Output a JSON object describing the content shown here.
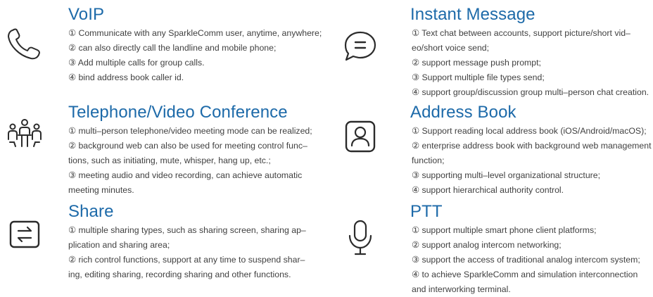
{
  "features": {
    "voip": {
      "icon": "phone-icon",
      "title": "VoIP",
      "lines": [
        "① Communicate with any SparkleComm user, anytime, anywhere;",
        "② can also directly call the landline and mobile phone;",
        "③ Add multiple calls for group calls.",
        "④ bind address book caller id."
      ]
    },
    "conference": {
      "icon": "meeting-people-icon",
      "title": "Telephone/Video Conference",
      "lines": [
        "① multi–person telephone/video meeting mode can be realized;",
        "② background web can also be used for meeting control func–",
        "tions, such as initiating, mute, whisper, hang up, etc.;",
        "③ meeting audio and video recording, can achieve automatic",
        "meeting minutes."
      ]
    },
    "share": {
      "icon": "share-arrows-icon",
      "title": "Share",
      "lines": [
        "① multiple sharing types, such as sharing screen, sharing ap–",
        "plication and sharing area;",
        "② rich control functions, support at any time to suspend shar–",
        "ing, editing sharing, recording sharing and other functions."
      ]
    },
    "im": {
      "icon": "chat-bubble-icon",
      "title": "Instant Message",
      "lines": [
        "① Text chat between accounts, support picture/short vid–",
        "eo/short voice send;",
        "② support message push prompt;",
        "③ Support multiple file types send;",
        "④ support group/discussion group multi–person chat creation."
      ]
    },
    "address": {
      "icon": "contact-person-icon",
      "title": "Address Book",
      "lines": [
        "① Support reading local address book (iOS/Android/macOS);",
        "② enterprise address book with background web management",
        "function;",
        "③ supporting multi–level organizational structure;",
        "④ support hierarchical authority control."
      ]
    },
    "ptt": {
      "icon": "microphone-icon",
      "title": "PTT",
      "lines": [
        "① support multiple smart phone client platforms;",
        "② support analog intercom networking;",
        "③ support the access of traditional analog intercom system;",
        "④ to achieve SparkleComm and simulation interconnection",
        "and interworking terminal."
      ]
    }
  },
  "colors": {
    "title": "#1d6aa9",
    "body_text": "#404040",
    "icon": "#2b2b2b"
  }
}
